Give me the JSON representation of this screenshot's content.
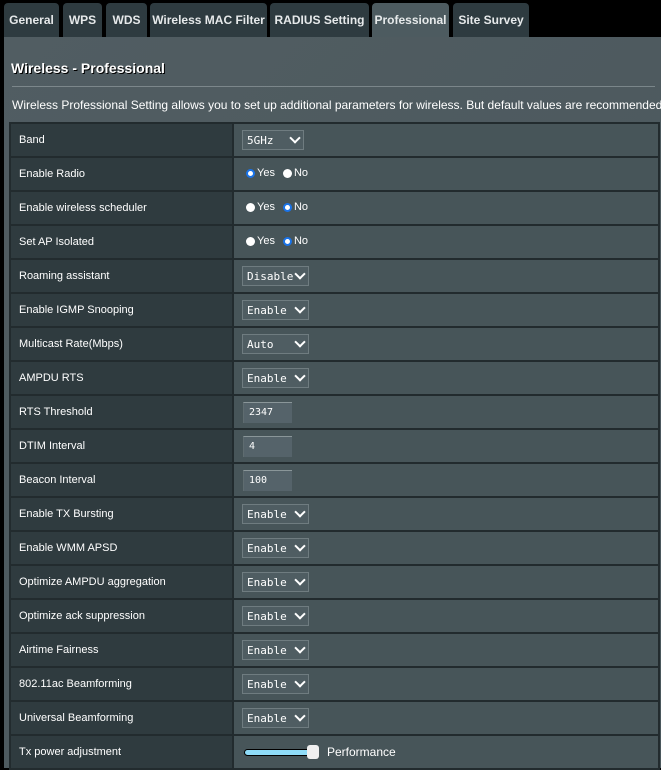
{
  "tabs": [
    {
      "label": "General",
      "active": false
    },
    {
      "label": "WPS",
      "active": false
    },
    {
      "label": "WDS",
      "active": false
    },
    {
      "label": "Wireless MAC Filter",
      "active": false
    },
    {
      "label": "RADIUS Setting",
      "active": false
    },
    {
      "label": "Professional",
      "active": true
    },
    {
      "label": "Site Survey",
      "active": false
    }
  ],
  "page": {
    "title": "Wireless - Professional",
    "description": "Wireless Professional Setting allows you to set up additional parameters for wireless. But default values are recommended."
  },
  "settings": {
    "band": {
      "label": "Band",
      "value": "5GHz"
    },
    "enable_radio": {
      "label": "Enable Radio",
      "yes": "Yes",
      "no": "No",
      "selected": "Yes"
    },
    "wireless_scheduler": {
      "label": "Enable wireless scheduler",
      "yes": "Yes",
      "no": "No",
      "selected": "No"
    },
    "ap_isolated": {
      "label": "Set AP Isolated",
      "yes": "Yes",
      "no": "No",
      "selected": "No"
    },
    "roaming_assistant": {
      "label": "Roaming assistant",
      "value": "Disable"
    },
    "igmp_snooping": {
      "label": "Enable IGMP Snooping",
      "value": "Enable"
    },
    "multicast_rate": {
      "label": "Multicast Rate(Mbps)",
      "value": "Auto"
    },
    "ampdu_rts": {
      "label": "AMPDU RTS",
      "value": "Enable"
    },
    "rts_threshold": {
      "label": "RTS Threshold",
      "value": "2347"
    },
    "dtim_interval": {
      "label": "DTIM Interval",
      "value": "4"
    },
    "beacon_interval": {
      "label": "Beacon Interval",
      "value": "100"
    },
    "tx_bursting": {
      "label": "Enable TX Bursting",
      "value": "Enable"
    },
    "wmm_apsd": {
      "label": "Enable WMM APSD",
      "value": "Enable"
    },
    "ampdu_aggregation": {
      "label": "Optimize AMPDU aggregation",
      "value": "Enable"
    },
    "ack_suppression": {
      "label": "Optimize ack suppression",
      "value": "Enable"
    },
    "airtime_fairness": {
      "label": "Airtime Fairness",
      "value": "Enable"
    },
    "beamforming_11ac": {
      "label": "802.11ac Beamforming",
      "value": "Enable"
    },
    "universal_beamforming": {
      "label": "Universal Beamforming",
      "value": "Enable"
    },
    "tx_power": {
      "label": "Tx power adjustment",
      "value_text": "Performance",
      "level_percent": 100
    }
  }
}
